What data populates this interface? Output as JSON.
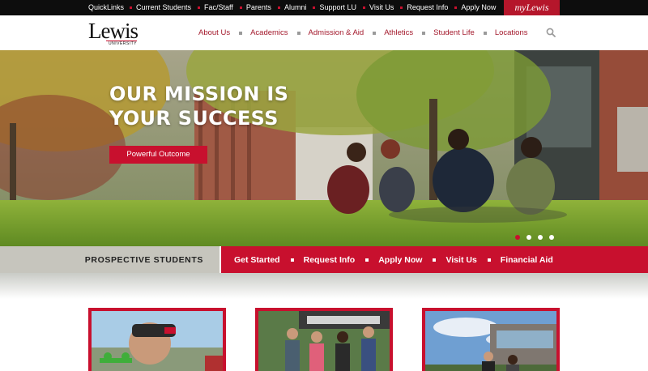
{
  "topbar": {
    "quicklinks_label": "QuickLinks",
    "links": [
      "Current Students",
      "Fac/Staff",
      "Parents",
      "Alumni",
      "Support LU",
      "Visit Us",
      "Request Info",
      "Apply Now"
    ],
    "mylewis_label": "myLewis"
  },
  "logo": {
    "name": "Lewis",
    "subtitle": "UNIVERSITY"
  },
  "nav": {
    "items": [
      "About Us",
      "Academics",
      "Admission & Aid",
      "Athletics",
      "Student Life",
      "Locations"
    ],
    "search_icon": "search-icon"
  },
  "hero": {
    "title": "OUR MISSION IS YOUR SUCCESS",
    "button_label": "Powerful Outcome",
    "slide_count": 4,
    "active_slide": 1
  },
  "prospective": {
    "label": "PROSPECTIVE STUDENTS",
    "links": [
      "Get Started",
      "Request Info",
      "Apply Now",
      "Visit Us",
      "Financial Aid"
    ]
  },
  "colors": {
    "accent": "#c8102e",
    "dark_bar": "#0d0d0d",
    "nav_text": "#a3182b",
    "strip_gray": "#c6c5bd"
  }
}
